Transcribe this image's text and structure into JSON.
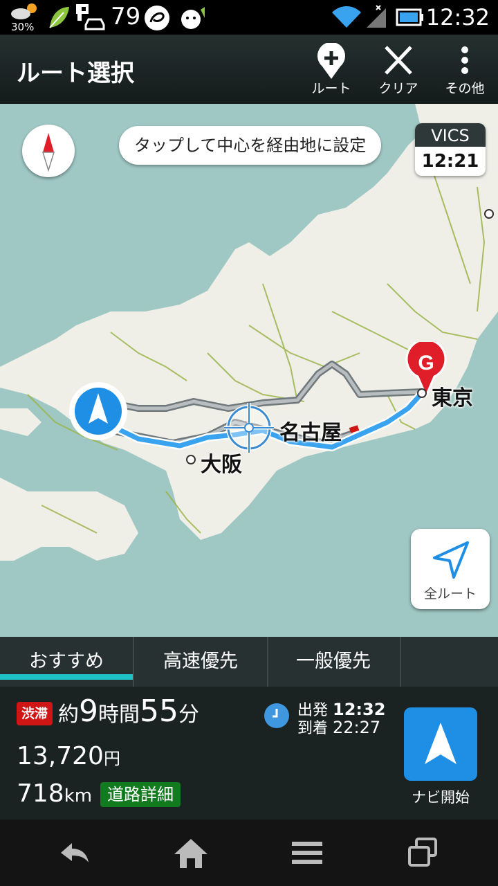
{
  "status_bar": {
    "battery_weather_pct": "30%",
    "signal_number": "79",
    "time": "12:32"
  },
  "app_bar": {
    "title": "ルート選択",
    "actions": [
      {
        "label": "ルート",
        "icon": "pin-add-icon"
      },
      {
        "label": "クリア",
        "icon": "close-icon"
      },
      {
        "label": "その他",
        "icon": "more-vert-icon"
      }
    ]
  },
  "map": {
    "hint": "タップして中心を経由地に設定",
    "vics": {
      "label": "VICS",
      "time": "12:21"
    },
    "cities": [
      "東京",
      "名古屋",
      "大阪"
    ],
    "goal_marker": "G",
    "all_route_label": "全ルート"
  },
  "tabs": [
    {
      "label": "おすすめ",
      "selected": true
    },
    {
      "label": "高速優先",
      "selected": false
    },
    {
      "label": "一般優先",
      "selected": false
    }
  ],
  "route_info": {
    "traffic_badge": "渋滞",
    "duration": {
      "prefix": "約",
      "hours": "9",
      "hours_unit": "時間",
      "minutes": "55",
      "minutes_unit": "分"
    },
    "departure": {
      "label": "出発",
      "time": "12:32"
    },
    "arrival": {
      "label": "到着",
      "time": "22:27"
    },
    "toll": {
      "value": "13,720",
      "unit": "円"
    },
    "distance": {
      "value": "718",
      "unit": "km"
    },
    "road_detail_label": "道路詳細",
    "start_navi_label": "ナビ開始"
  },
  "colors": {
    "accent": "#1fc2c6",
    "route_blue": "#3aa3ef",
    "alt_route": "#8a9396",
    "goal_red": "#e01e2a",
    "traffic_red": "#d01515",
    "road_green": "#127a1f"
  }
}
